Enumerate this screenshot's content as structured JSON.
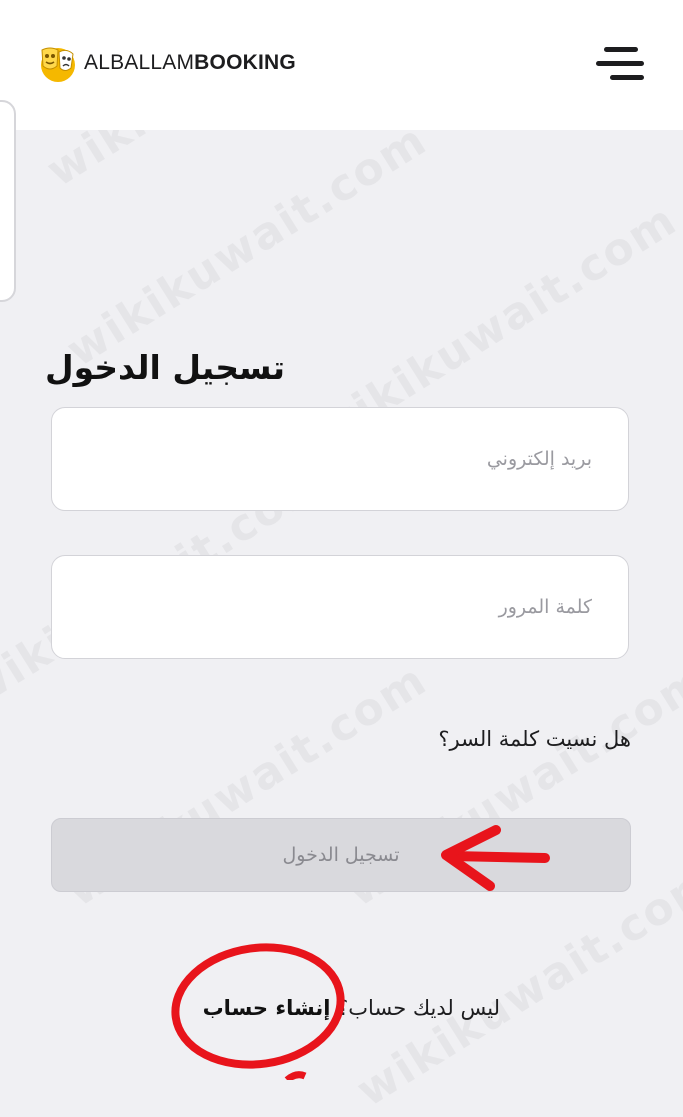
{
  "header": {
    "logo_light": "ALBALLAM",
    "logo_bold": "BOOKING",
    "logo_icon": "mask-logo-icon",
    "menu_icon": "hamburger-menu-icon"
  },
  "login": {
    "title": "تسجيل الدخول",
    "email_placeholder": "بريد إلكتروني",
    "password_placeholder": "كلمة المرور",
    "forgot_password": "هل نسيت كلمة السر؟",
    "submit_label": "تسجيل الدخول",
    "no_account_text": "ليس لديك حساب؟ ",
    "create_account": "إنشاء حساب"
  },
  "watermark": "wikikuwait.com",
  "colors": {
    "background": "#f0f0f3",
    "header": "#ffffff",
    "logo_yellow": "#f5b800",
    "button_disabled": "#d9d9dd",
    "annotation_red": "#e8141b"
  }
}
